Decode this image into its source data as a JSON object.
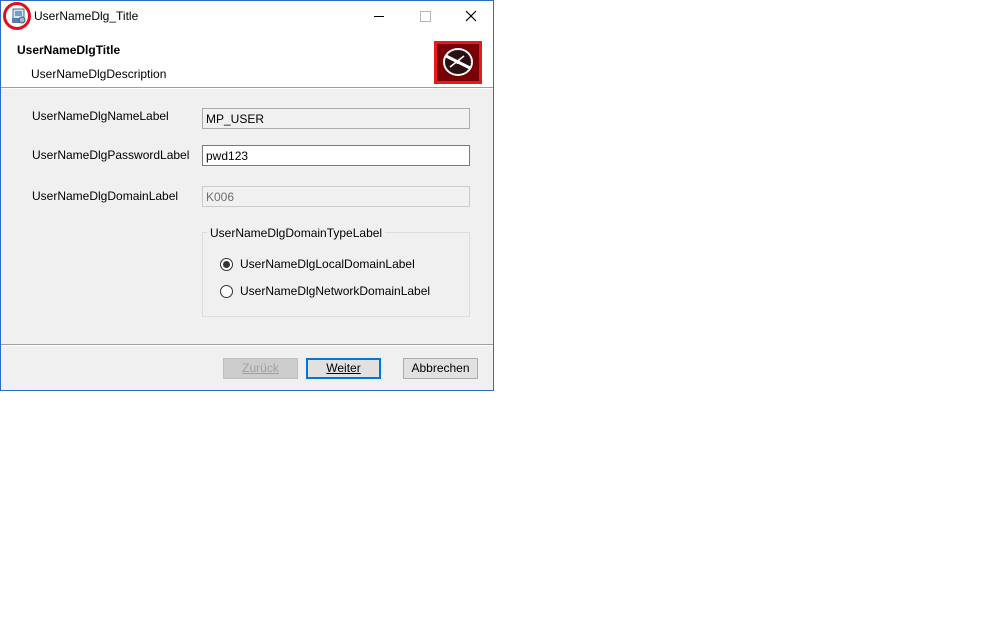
{
  "window": {
    "title": "UserNameDlg_Title"
  },
  "header": {
    "title": "UserNameDlgTitle",
    "description": "UserNameDlgDescription",
    "banner_icon": "disk-icon"
  },
  "form": {
    "name_label": "UserNameDlgNameLabel",
    "name_value": "MP_USER",
    "password_label": "UserNameDlgPasswordLabel",
    "password_value": "pwd123",
    "domain_label": "UserNameDlgDomainLabel",
    "domain_value": "K006"
  },
  "domain_type": {
    "legend": "UserNameDlgDomainTypeLabel",
    "options": [
      {
        "label": "UserNameDlgLocalDomainLabel",
        "selected": true
      },
      {
        "label": "UserNameDlgNetworkDomainLabel",
        "selected": false
      }
    ]
  },
  "buttons": {
    "back_label": "Zurück",
    "next_label": "Weiter",
    "cancel_label": "Abbrechen"
  },
  "colors": {
    "accent": "#0078d7",
    "highlight_ring": "#e0101a",
    "banner_bg": "#c8000a"
  }
}
